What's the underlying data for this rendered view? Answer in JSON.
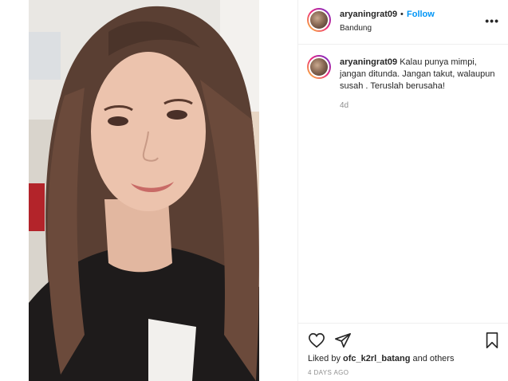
{
  "header": {
    "username": "aryaningrat09",
    "separator": "•",
    "follow_label": "Follow",
    "location": "Bandung",
    "more_icon": "more-options-icon"
  },
  "caption": {
    "username": "aryaningrat09",
    "text": "Kalau punya mimpi, jangan ditunda. Jangan takut, walaupun susah . Teruslah berusaha!",
    "time": "4d"
  },
  "footer": {
    "liked_prefix": "Liked by",
    "liked_user": "ofc_k2rl_batang",
    "liked_suffix": "and others",
    "date": "4 DAYS AGO",
    "icons": [
      "heart-icon",
      "share-icon",
      "bookmark-icon"
    ]
  },
  "colors": {
    "follow": "#0095f6",
    "text": "#262626",
    "muted": "#8e8e8e",
    "divider": "#efefef"
  }
}
